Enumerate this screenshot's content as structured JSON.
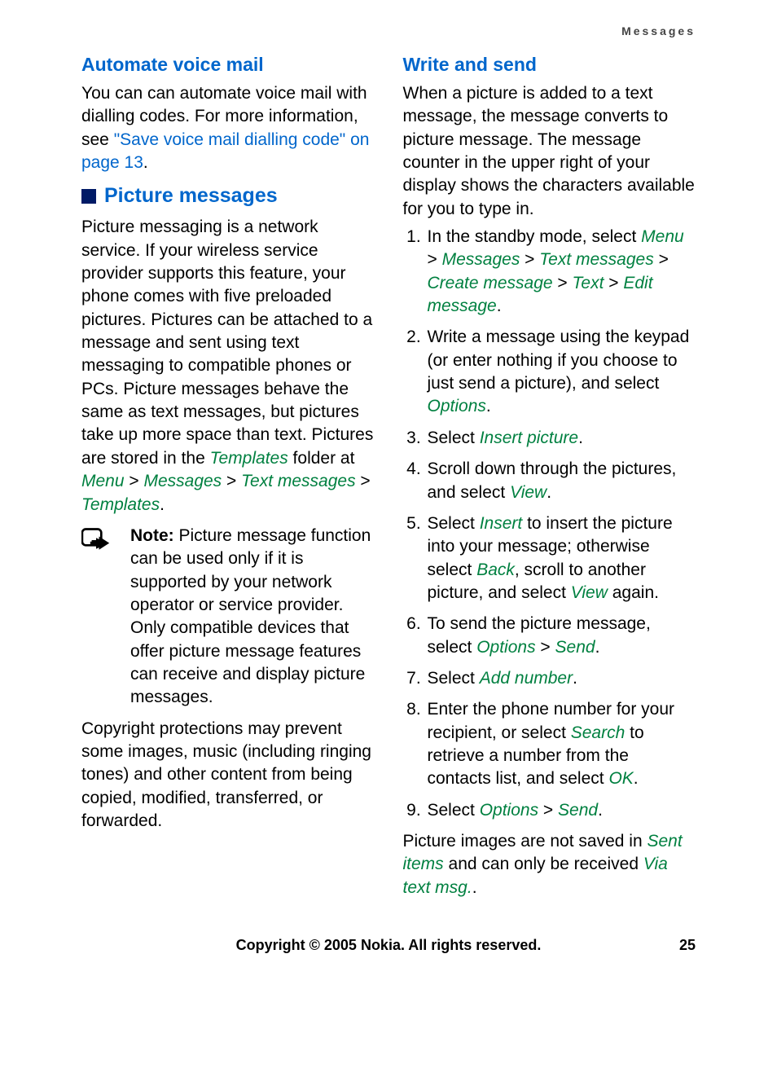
{
  "header": {
    "section": "Messages"
  },
  "left": {
    "h1": "Automate voice mail",
    "p1_a": "You can can automate voice mail with dialling codes. For more information, see ",
    "p1_link": "\"Save voice mail dialling code\" on page 13",
    "p1_b": ".",
    "h2": "Picture messages",
    "p2_a": "Picture messaging is a network service. If your wireless service provider supports this feature, your phone comes with five preloaded pictures. Pictures can be attached to a message and sent using text messaging to compatible phones or PCs. Picture messages behave the same as text messages, but pictures take up more space than text. Pictures are stored in the ",
    "p2_t1": "Templates",
    "p2_b": " folder at ",
    "p2_m1": "Menu",
    "p2_s1": " > ",
    "p2_m2": "Messages",
    "p2_s2": " > ",
    "p2_m3": "Text messages",
    "p2_s3": " > ",
    "p2_m4": "Templates",
    "p2_c": ".",
    "note_label": "Note: ",
    "note_text": "Picture message function can be used only if it is supported by your network operator or service provider. Only compatible devices that offer picture message features can receive and display picture messages.",
    "p3": "Copyright protections may prevent some images, music (including ringing tones) and other content from being copied, modified, transferred, or forwarded."
  },
  "right": {
    "h1": "Write and send",
    "intro": "When a picture is added to a text message, the message converts to picture message. The message counter in the upper right of your display shows the characters available for you to type in.",
    "steps": [
      {
        "a": "In the standby mode, select ",
        "m1": "Menu",
        "s1": " > ",
        "m2": "Messages",
        "s2": " > ",
        "m3": "Text messages",
        "s3": " > ",
        "m4": "Create message",
        "s4": " > ",
        "m5": "Text",
        "s5": " > ",
        "m6": "Edit message",
        "z": "."
      },
      {
        "a": "Write a message using the keypad (or enter nothing if you choose to just send a picture), and select ",
        "m1": "Options",
        "z": "."
      },
      {
        "a": "Select ",
        "m1": "Insert picture",
        "z": "."
      },
      {
        "a": "Scroll down through the pictures, and select ",
        "m1": "View",
        "z": "."
      },
      {
        "a": "Select ",
        "m1": "Insert",
        "b": " to insert the picture into your message; otherwise select ",
        "m2": "Back",
        "c": ", scroll to another picture, and select ",
        "m3": "View",
        "d": " again."
      },
      {
        "a": "To send the picture message, select ",
        "m1": "Options",
        "s1": " > ",
        "m2": "Send",
        "z": "."
      },
      {
        "a": "Select ",
        "m1": "Add number",
        "z": "."
      },
      {
        "a": "Enter the phone number for your recipient, or select ",
        "m1": "Search",
        "b": " to retrieve a number from the contacts list, and select ",
        "m2": "OK",
        "z": "."
      },
      {
        "a": "Select ",
        "m1": "Options",
        "s1": " > ",
        "m2": "Send",
        "z": "."
      }
    ],
    "p_end_a": "Picture images are not saved in ",
    "p_end_m1": "Sent items",
    "p_end_b": " and can only be received ",
    "p_end_m2": "Via text msg.",
    "p_end_c": "."
  },
  "footer": {
    "copyright": "Copyright © 2005 Nokia. All rights reserved.",
    "page": "25"
  }
}
